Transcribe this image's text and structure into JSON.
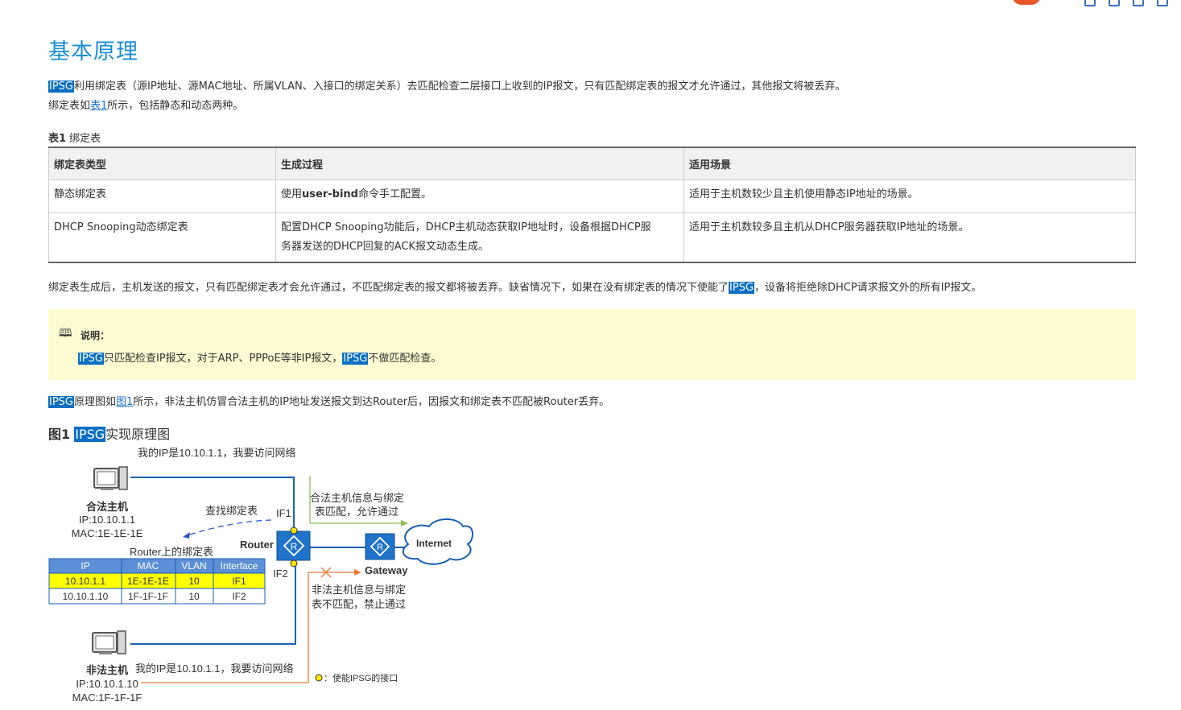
{
  "page": {
    "title": "基本原理",
    "highlight_term": "IPSG"
  },
  "intro": {
    "line1_hl": "IPSG",
    "line1_rest": "利用绑定表（源IP地址、源MAC地址、所属VLAN、入接口的绑定关系）去匹配检查二层接口上收到的IP报文，只有匹配绑定表的报文才允许通过，其他报文将被丢弃。",
    "line2_before": "绑定表如",
    "line2_link": "表1",
    "line2_after": "所示，包括静态和动态两种。"
  },
  "table": {
    "caption_bold": "表1",
    "caption_text": " 绑定表",
    "headers": [
      "绑定表类型",
      "生成过程",
      "适用场景"
    ],
    "rows": [
      {
        "type": "静态绑定表",
        "process_before": "使用",
        "process_bold": "user-bind",
        "process_after": "命令手工配置。",
        "scene": "适用于主机数较少且主机使用静态IP地址的场景。"
      },
      {
        "type": "DHCP Snooping动态绑定表",
        "process_line1": "配置DHCP Snooping功能后，DHCP主机动态获取IP地址时，设备根据DHCP服",
        "process_line2": "务器发送的DHCP回复的ACK报文动态生成。",
        "scene": "适用于主机数较多且主机从DHCP服务器获取IP地址的场景。"
      }
    ]
  },
  "after_table": {
    "before": "绑定表生成后，主机发送的报文，只有匹配绑定表才会允许通过，不匹配绑定表的报文都将被丢弃。缺省情况下，如果在没有绑定表的情况下使能了",
    "hl": "IPSG",
    "after": "，设备将拒绝除DHCP请求报文外的所有IP报文。"
  },
  "note": {
    "label": "说明：",
    "hl1": "IPSG",
    "mid": "只匹配检查IP报文，对于ARP、PPPoE等非IP报文，",
    "hl2": "IPSG",
    "end": "不做匹配检查。"
  },
  "figure_intro": {
    "hl": "IPSG",
    "before_link": "原理图如",
    "link": "图1",
    "after_link": "所示，非法主机仿冒合法主机的IP地址发送报文到达Router后，因报文和绑定表不匹配被Router丢弃。"
  },
  "figure": {
    "caption_bold": "图1",
    "caption_hl": "IPSG",
    "caption_text": "实现原理图",
    "legal_host": {
      "name": "合法主机",
      "ip": "IP:10.10.1.1",
      "mac": "MAC:1E-1E-1E",
      "speech": "我的IP是10.10.1.1，我要访问网络"
    },
    "illegal_host": {
      "name": "非法主机",
      "ip": "IP:10.10.1.10",
      "mac": "MAC:1F-1F-1F",
      "speech": "我的IP是10.10.1.1，我要访问网络"
    },
    "lookup_label": "查找绑定表",
    "router_label": "Router",
    "if1": "IF1",
    "if2": "IF2",
    "gateway_label": "Gateway",
    "internet_label": "Internet",
    "allow_line1": "合法主机信息与绑定",
    "allow_line2": "表匹配，允许通过",
    "deny_line1": "非法主机信息与绑定",
    "deny_line2": "表不匹配，禁止通过",
    "legend": "：使能IPSG的接口",
    "bind_table": {
      "title": "Router上的绑定表",
      "headers": [
        "IP",
        "MAC",
        "VLAN",
        "Interface"
      ],
      "rows": [
        [
          "10.10.1.1",
          "1E-1E-1E",
          "10",
          "IF1"
        ],
        [
          "10.10.1.10",
          "1F-1F-1F",
          "10",
          "IF2"
        ]
      ]
    }
  },
  "colors": {
    "title": "#1a8fd6",
    "highlight_bg": "#0a6fc2",
    "note_bg": "#fdfbd1",
    "line_blue": "#1a5fb4",
    "allow_green": "#8fbf5a",
    "deny_orange": "#e87a3a",
    "row_yellow": "#ffff00",
    "table_head_blue": "#5b8fd6"
  }
}
